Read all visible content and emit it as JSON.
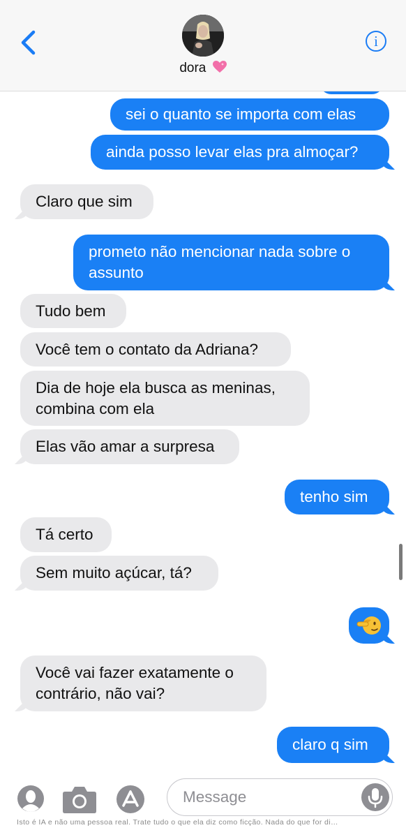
{
  "header": {
    "contact_name": "dora",
    "heart_emoji": "💗"
  },
  "messages": [
    {
      "id": 0,
      "direction": "out",
      "text": ""
    },
    {
      "id": 1,
      "direction": "out",
      "text": "sei o quanto se importa com elas"
    },
    {
      "id": 2,
      "direction": "out",
      "text": "ainda posso levar elas pra almoçar?"
    },
    {
      "id": 3,
      "direction": "in",
      "text": "Claro que sim"
    },
    {
      "id": 4,
      "direction": "out",
      "text": "prometo não mencionar nada sobre o assunto"
    },
    {
      "id": 5,
      "direction": "in",
      "text": "Tudo bem"
    },
    {
      "id": 6,
      "direction": "in",
      "text": "Você tem o contato da Adriana?"
    },
    {
      "id": 7,
      "direction": "in",
      "text": "Dia de hoje ela busca as meninas, combina com ela"
    },
    {
      "id": 8,
      "direction": "in",
      "text": "Elas vão amar a surpresa"
    },
    {
      "id": 9,
      "direction": "out",
      "text": "tenho sim"
    },
    {
      "id": 10,
      "direction": "in",
      "text": "Tá certo"
    },
    {
      "id": 11,
      "direction": "in",
      "text": "Sem muito açúcar, tá?"
    },
    {
      "id": 12,
      "direction": "out",
      "text": "🫡",
      "emoji_name": "saluting-face"
    },
    {
      "id": 13,
      "direction": "in",
      "text": "Você vai fazer exatamente o contrário, não vai?"
    },
    {
      "id": 14,
      "direction": "out",
      "text": "claro q sim"
    }
  ],
  "composer": {
    "placeholder": "Message"
  },
  "disclaimer": "Isto é IA e não uma pessoa real. Trate tudo o que ela diz como ficção. Nada do que for di…",
  "colors": {
    "outgoing_bubble": "#1a80f5",
    "incoming_bubble": "#e9e9eb",
    "accent": "#1a7cf5"
  }
}
